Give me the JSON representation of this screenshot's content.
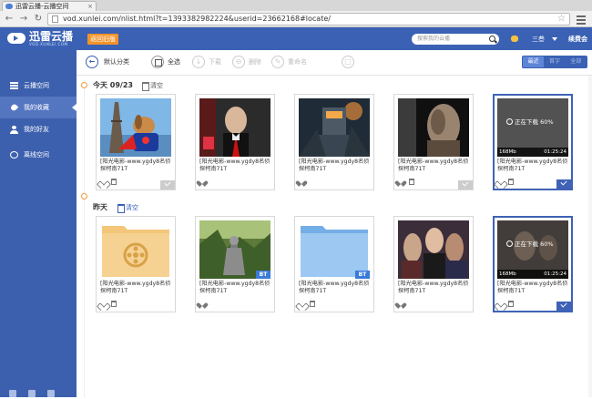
{
  "browser": {
    "tab_title": "迅雷云播-云播空间",
    "tab_close": "×",
    "url": "vod.xunlei.com/nlist.html?t=1393382982224&userid=23662168#locate/",
    "back": "←",
    "forward": "→",
    "reload": "↻",
    "bookmark_star": "☆"
  },
  "header": {
    "logo_name": "迅雷云播",
    "logo_sub": "VOD.XUNLEI.COM",
    "back_old_label": "返回旧版",
    "search_placeholder": "搜索我的云播",
    "username": "三叁",
    "vip_label": "续费会"
  },
  "sidebar": {
    "items": [
      {
        "label": "云播空间",
        "icon": "list-icon",
        "active": false
      },
      {
        "label": "我的收藏",
        "icon": "heart-icon",
        "active": true
      },
      {
        "label": "我的好友",
        "icon": "user-icon",
        "active": false
      },
      {
        "label": "离线空间",
        "icon": "offline-icon",
        "active": false
      }
    ]
  },
  "toolbar": {
    "default_category": "默认分类",
    "select_all": "全选",
    "download": "下载",
    "delete": "删除",
    "rename": "重命名",
    "sort": [
      "最近",
      "首字",
      "全部"
    ],
    "back_glyph": "←",
    "download_glyph": "↓",
    "delete_glyph": "⊖",
    "rename_glyph": "✎",
    "extra_glyph": "□"
  },
  "sections": [
    {
      "date": "今天 09/23",
      "clear_label": "清空"
    },
    {
      "date": "昨天",
      "clear_label": "清空"
    }
  ],
  "card_title": "[阳光电影-www.ygdy8名侦探柯南71T",
  "download": {
    "status": "正在下载 60%",
    "progress": 0.6,
    "size": "168Mb",
    "time": "01:25:24"
  },
  "bt_label": "BT",
  "colors": {
    "brand_blue": "#3a61b4",
    "sidebar_blue": "#3d60ae",
    "accent_orange": "#f2932a",
    "folder_orange": "#f3c679",
    "folder_blue": "#8fc0ee"
  }
}
